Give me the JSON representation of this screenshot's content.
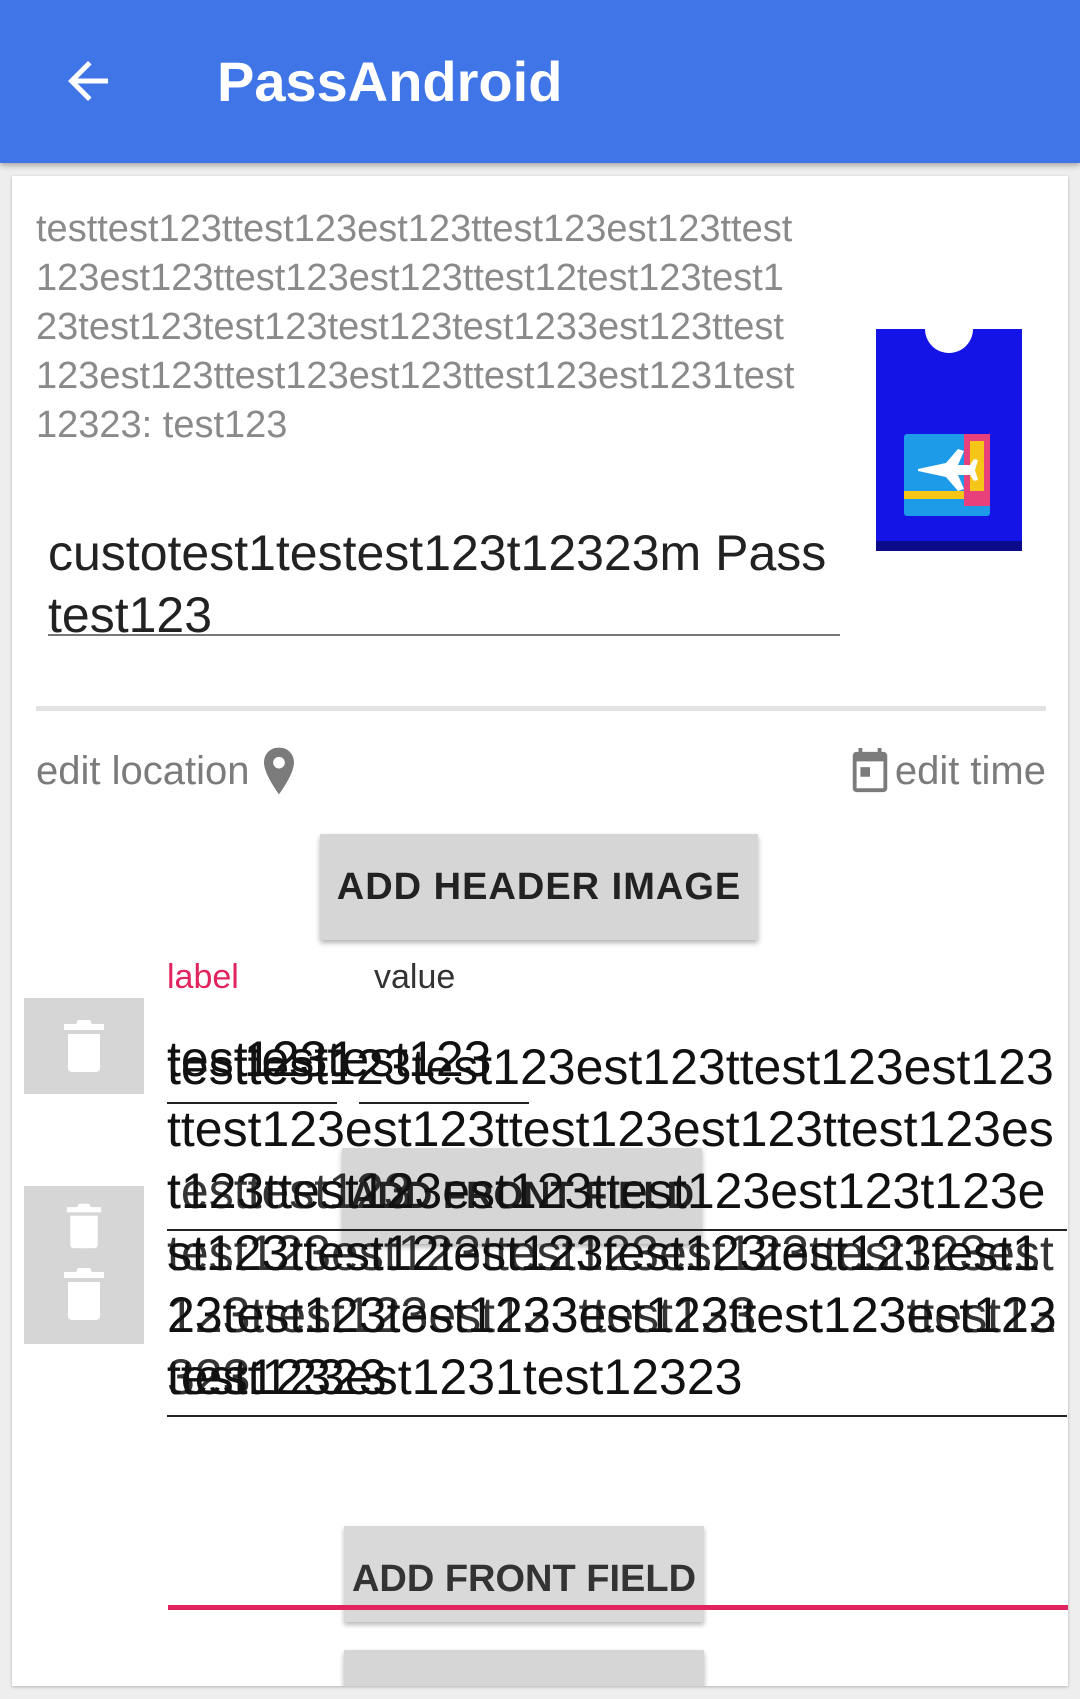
{
  "app_bar": {
    "title": "PassAndroid",
    "back_icon": "arrow-left-icon"
  },
  "pass": {
    "description": "testtest123ttest123est123ttest123est123ttest123est123ttest123est123ttest12test123test123test123test123test123test1233est123ttest123est123ttest123est123ttest123est1231test12323: test123",
    "title_value": "custotest1testest123t12323m Passtest123",
    "icon": "boarding-pass-icon"
  },
  "actions": {
    "edit_location": "edit location",
    "location_icon": "map-pin-icon",
    "edit_time": "edit time",
    "time_icon": "calendar-icon",
    "add_header_image": "ADD HEADER IMAGE"
  },
  "fields": {
    "label_header": "label",
    "value_header": "value",
    "delete_icon": "trash-icon",
    "field1_label": "testtest123",
    "field1_value": "123test123",
    "field2_label": "testtest123",
    "field2_value": "test123est123ttest123est123ttest123est123ttest123est123ttest123est123ttest12323",
    "field3_label": "test12323",
    "editing_value": "testtest123test123est123ttest123est123ttest123est123ttest123est123ttest123est123ttest123est123ttest123est123t123est123ttest12test123test123test123test123test123test1233est123ttest123est123ttest123est1231test12323",
    "add_front_field": "ADD FRONT FIELD"
  },
  "colors": {
    "primary": "#3f75e6",
    "accent": "#e0245e"
  }
}
